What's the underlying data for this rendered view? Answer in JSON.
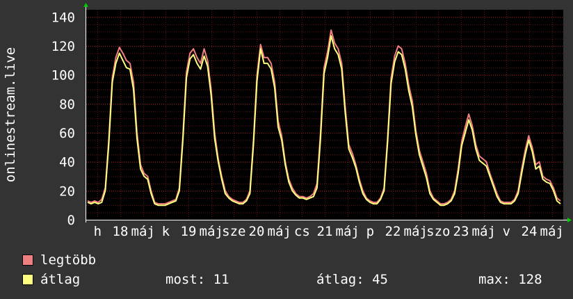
{
  "chart_data": {
    "type": "line",
    "ylabel": "onlinestream.live",
    "ylim": [
      0,
      145
    ],
    "y_ticks": [
      0,
      20,
      40,
      60,
      80,
      100,
      120,
      140
    ],
    "x_tick_labels": [
      "h",
      "18",
      "máj",
      "k",
      "19",
      "máj",
      "sze",
      "20",
      "máj",
      "cs",
      "21",
      "máj",
      "p",
      "22",
      "máj",
      "szo",
      "23",
      "máj",
      "v",
      "24",
      "máj"
    ],
    "colors": {
      "legtobb": "#f08080",
      "atlag": "#ffff80",
      "grid": "#aa2020",
      "background": "#000000",
      "axis_arrow": "#00cc00"
    },
    "series": [
      {
        "name": "legtöbb",
        "values": [
          13,
          12,
          13,
          12,
          14,
          22,
          55,
          98,
          112,
          119,
          115,
          110,
          108,
          95,
          60,
          38,
          32,
          30,
          20,
          12,
          11,
          11,
          11,
          12,
          13,
          14,
          22,
          58,
          102,
          115,
          118,
          112,
          108,
          118,
          110,
          90,
          60,
          42,
          30,
          20,
          16,
          14,
          13,
          12,
          12,
          14,
          20,
          55,
          100,
          121,
          112,
          112,
          108,
          95,
          68,
          58,
          40,
          28,
          22,
          18,
          16,
          16,
          15,
          16,
          18,
          25,
          60,
          105,
          116,
          131,
          122,
          118,
          108,
          78,
          52,
          46,
          38,
          28,
          20,
          15,
          13,
          12,
          12,
          15,
          22,
          56,
          98,
          113,
          120,
          118,
          108,
          93,
          82,
          62,
          48,
          40,
          32,
          20,
          15,
          13,
          11,
          11,
          12,
          14,
          20,
          35,
          54,
          64,
          73,
          65,
          52,
          44,
          42,
          40,
          32,
          25,
          18,
          13,
          12,
          12,
          12,
          14,
          20,
          35,
          48,
          58,
          50,
          38,
          40,
          30,
          28,
          27,
          22,
          15,
          13
        ]
      },
      {
        "name": "átlag",
        "values": [
          12,
          11,
          12,
          11,
          12,
          20,
          52,
          95,
          108,
          115,
          110,
          105,
          104,
          90,
          56,
          35,
          30,
          28,
          18,
          11,
          10,
          10,
          10,
          11,
          12,
          13,
          20,
          55,
          98,
          111,
          114,
          108,
          104,
          113,
          106,
          86,
          56,
          40,
          28,
          18,
          15,
          13,
          12,
          11,
          11,
          13,
          18,
          52,
          96,
          118,
          108,
          108,
          104,
          91,
          64,
          55,
          38,
          26,
          20,
          17,
          15,
          15,
          14,
          15,
          16,
          22,
          56,
          101,
          112,
          127,
          118,
          114,
          104,
          74,
          49,
          43,
          36,
          26,
          18,
          14,
          12,
          11,
          11,
          14,
          20,
          53,
          94,
          109,
          116,
          114,
          104,
          89,
          78,
          59,
          45,
          37,
          29,
          18,
          14,
          12,
          10,
          10,
          11,
          13,
          18,
          32,
          51,
          60,
          69,
          62,
          49,
          41,
          39,
          37,
          30,
          23,
          16,
          12,
          11,
          11,
          11,
          13,
          18,
          32,
          45,
          55,
          47,
          35,
          37,
          28,
          26,
          25,
          20,
          13,
          11
        ]
      }
    ],
    "legend": [
      "legtöbb",
      "átlag"
    ],
    "legend_placement": "bottom-left",
    "grid": true
  },
  "legend": {
    "max_label": "legtöbb",
    "avg_label": "átlag"
  },
  "stats": {
    "now": "most: 11",
    "avg": "átlag: 45",
    "max": "max: 128"
  }
}
